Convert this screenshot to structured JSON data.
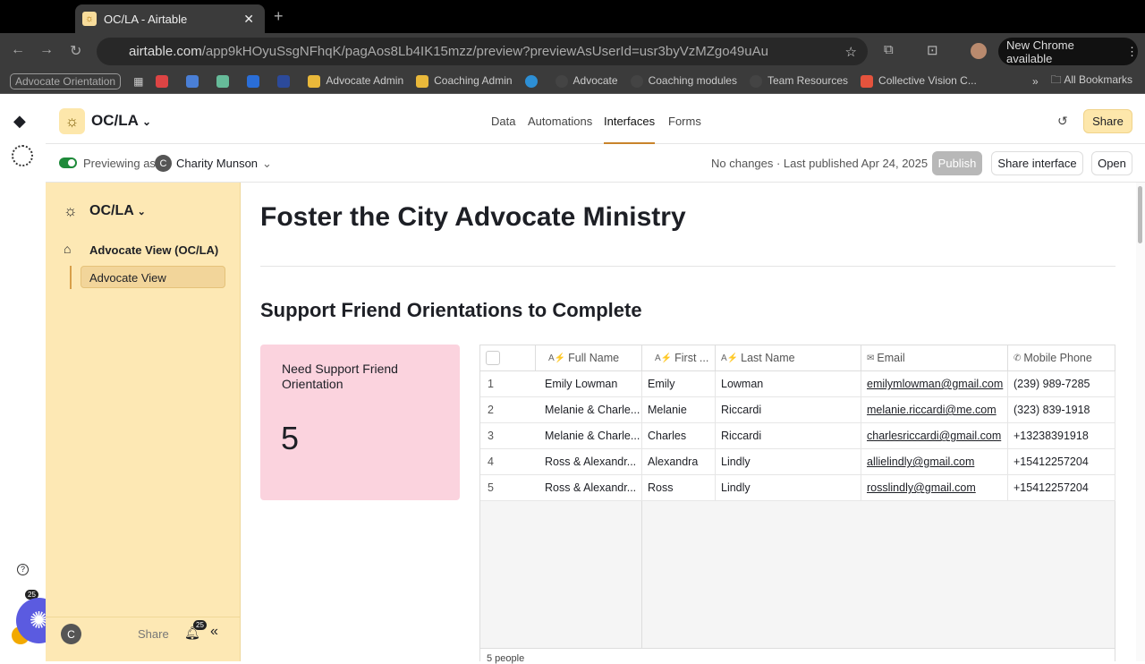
{
  "browser": {
    "tab_title": "OC/LA - Airtable",
    "url_domain": "airtable.com",
    "url_path": "/app9kHOyuSsgNFhqK/pagAos8Lb4IK15mzz/preview?previewAsUserId=usr3byVzMZgo49uAu",
    "chrome_update": "New Chrome available",
    "bookmark_group": "Advocate Orientation",
    "bookmarks": [
      "Advocate Admin",
      "Coaching Admin",
      "Advocate",
      "Coaching modules",
      "Team Resources",
      "Collective Vision C..."
    ],
    "all_bookmarks": "All Bookmarks"
  },
  "header": {
    "base_name": "OC/LA",
    "nav": [
      "Data",
      "Automations",
      "Interfaces",
      "Forms"
    ],
    "active_nav": "Interfaces",
    "share": "Share"
  },
  "preview_bar": {
    "previewing_as": "Previewing as",
    "user_initial": "C",
    "user_name": "Charity Munson",
    "status": "No changes · Last published Apr 24, 2025",
    "publish": "Publish",
    "share_interface": "Share interface",
    "open": "Open"
  },
  "sidebar": {
    "title": "OC/LA",
    "section": "Advocate View (OC/LA)",
    "page": "Advocate View",
    "share": "Share",
    "avatar": "C",
    "notifications": "25"
  },
  "rail": {
    "notifications": "25"
  },
  "main": {
    "title": "Foster the City Advocate Ministry",
    "section_title": "Support Friend Orientations to Complete",
    "card": {
      "label": "Need Support Friend Orientation",
      "value": "5"
    },
    "table": {
      "columns": [
        "Full Name",
        "First ...",
        "Last Name",
        "Email",
        "Mobile Phone"
      ],
      "rows": [
        [
          "1",
          "Emily Lowman",
          "Emily",
          "Lowman",
          "emilymlowman@gmail.com",
          "(239) 989-7285"
        ],
        [
          "2",
          "Melanie & Charle...",
          "Melanie",
          "Riccardi",
          "melanie.riccardi@me.com",
          "(323) 839-1918"
        ],
        [
          "3",
          "Melanie & Charle...",
          "Charles",
          "Riccardi",
          "charlesriccardi@gmail.com",
          "+13238391918"
        ],
        [
          "4",
          "Ross & Alexandr...",
          "Alexandra",
          "Lindly",
          "allielindly@gmail.com",
          "+15412257204"
        ],
        [
          "5",
          "Ross & Alexandr...",
          "Ross",
          "Lindly",
          "rosslindly@gmail.com",
          "+15412257204"
        ]
      ],
      "footer": "5 people"
    }
  },
  "colors": {
    "sidebar": "#fde8b4",
    "card": "#fbd3de",
    "accent": "#fde7ab",
    "fab": "#5b5be0"
  }
}
